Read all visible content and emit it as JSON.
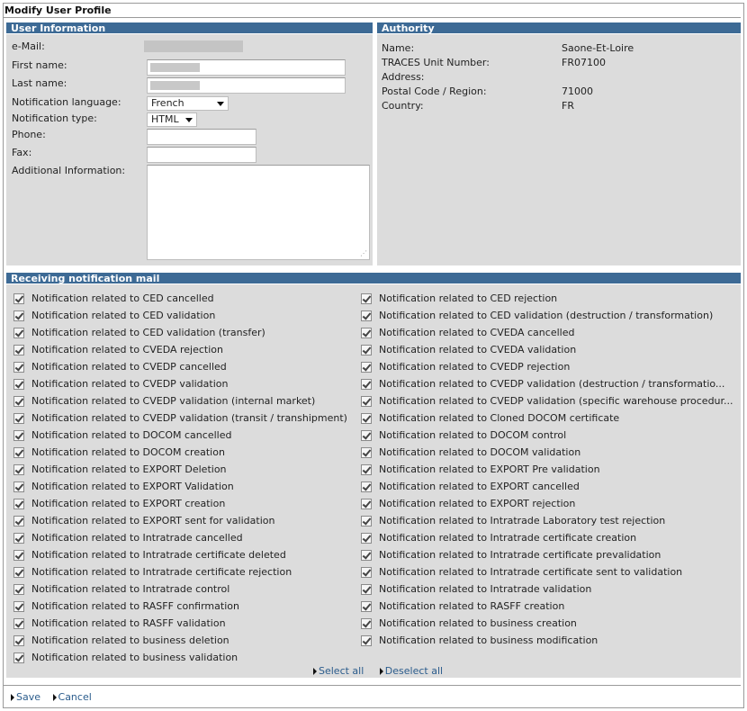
{
  "page": {
    "title": "Modify User Profile"
  },
  "user_info": {
    "header": "User Information",
    "email_label": "e-Mail:",
    "first_name_label": "First name:",
    "last_name_label": "Last name:",
    "language_label": "Notification language:",
    "language_value": "French",
    "type_label": "Notification type:",
    "type_value": "HTML",
    "phone_label": "Phone:",
    "fax_label": "Fax:",
    "additional_label": "Additional Information:"
  },
  "authority": {
    "header": "Authority",
    "name_label": "Name:",
    "name_value": "Saone-Et-Loire",
    "unit_label": "TRACES Unit Number:",
    "unit_value": "FR07100",
    "address_label": "Address:",
    "postal_label": "Postal Code / Region:",
    "postal_value": "71000",
    "country_label": "Country:",
    "country_value": "FR"
  },
  "notifications": {
    "header": "Receiving notification mail",
    "left": [
      "Notification related to CED cancelled",
      "Notification related to CED validation",
      "Notification related to CED validation (transfer)",
      "Notification related to CVEDA rejection",
      "Notification related to CVEDP cancelled",
      "Notification related to CVEDP validation",
      "Notification related to CVEDP validation (internal market)",
      "Notification related to CVEDP validation (transit / transhipment)",
      "Notification related to DOCOM cancelled",
      "Notification related to DOCOM creation",
      "Notification related to EXPORT Deletion",
      "Notification related to EXPORT Validation",
      "Notification related to EXPORT creation",
      "Notification related to EXPORT sent for validation",
      "Notification related to Intratrade cancelled",
      "Notification related to Intratrade certificate deleted",
      "Notification related to Intratrade certificate rejection",
      "Notification related to Intratrade control",
      "Notification related to RASFF confirmation",
      "Notification related to RASFF validation",
      "Notification related to business deletion",
      "Notification related to business validation"
    ],
    "right": [
      "Notification related to CED rejection",
      "Notification related to CED validation (destruction / transformation)",
      "Notification related to CVEDA cancelled",
      "Notification related to CVEDA validation",
      "Notification related to CVEDP rejection",
      "Notification related to CVEDP validation (destruction / transformatio...",
      "Notification related to CVEDP validation (specific warehouse procedur...",
      "Notification related to Cloned DOCOM certificate",
      "Notification related to DOCOM control",
      "Notification related to DOCOM validation",
      "Notification related to EXPORT Pre validation",
      "Notification related to EXPORT cancelled",
      "Notification related to EXPORT rejection",
      "Notification related to Intratrade Laboratory test rejection",
      "Notification related to Intratrade certificate creation",
      "Notification related to Intratrade certificate prevalidation",
      "Notification related to Intratrade certificate sent to validation",
      "Notification related to Intratrade validation",
      "Notification related to RASFF creation",
      "Notification related to business creation",
      "Notification related to business modification"
    ],
    "select_all": "Select all",
    "deselect_all": "Deselect all"
  },
  "actions": {
    "save": "Save",
    "cancel": "Cancel"
  }
}
